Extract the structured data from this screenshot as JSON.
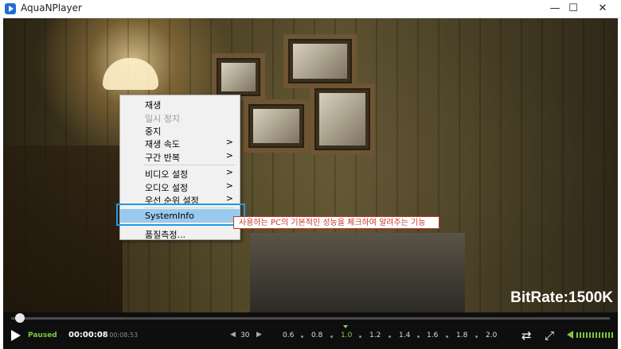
{
  "window": {
    "title": "AquaNPlayer",
    "minimize_glyph": "—",
    "maximize_glyph": "☐",
    "close_glyph": "✕"
  },
  "overlay": {
    "bitrate": "BitRate:1500K"
  },
  "context_menu": {
    "items": [
      {
        "label": "재생",
        "enabled": true,
        "submenu": false
      },
      {
        "label": "일시 정지",
        "enabled": false,
        "submenu": false
      },
      {
        "label": "중지",
        "enabled": true,
        "submenu": false
      },
      {
        "label": "재생 속도",
        "enabled": true,
        "submenu": true
      },
      {
        "label": "구간 반복",
        "enabled": true,
        "submenu": true
      },
      {
        "label": "비디오 설정",
        "enabled": true,
        "submenu": true
      },
      {
        "label": "오디오 설정",
        "enabled": true,
        "submenu": true
      },
      {
        "label": "우선 순위 설정",
        "enabled": true,
        "submenu": true
      },
      {
        "label": "SystemInfo",
        "enabled": true,
        "submenu": false,
        "highlighted": true
      },
      {
        "label": "품질측정...",
        "enabled": true,
        "submenu": false
      }
    ],
    "submenu_arrow": ">"
  },
  "tooltip": {
    "text": "사용하는 PC의 기본적인 성능을 체크하여 알려주는 기능"
  },
  "controls": {
    "status": "Paused",
    "current_time": "00:00:08",
    "duration": "/ 00:08:53",
    "skip_back": "◀",
    "skip_value": "30",
    "skip_forward": "▶",
    "speeds": [
      "0.6",
      "0.8",
      "1.0",
      "1.2",
      "1.4",
      "1.6",
      "1.8",
      "2.0"
    ],
    "active_speed": "1.0",
    "seek_progress": 0.015,
    "repeat_glyph": "⇄",
    "fullscreen_glyph": "⤢"
  },
  "colors": {
    "accent_green": "#7ac943",
    "highlight_blue": "#1e9be6",
    "tooltip_red": "#c0392b"
  }
}
